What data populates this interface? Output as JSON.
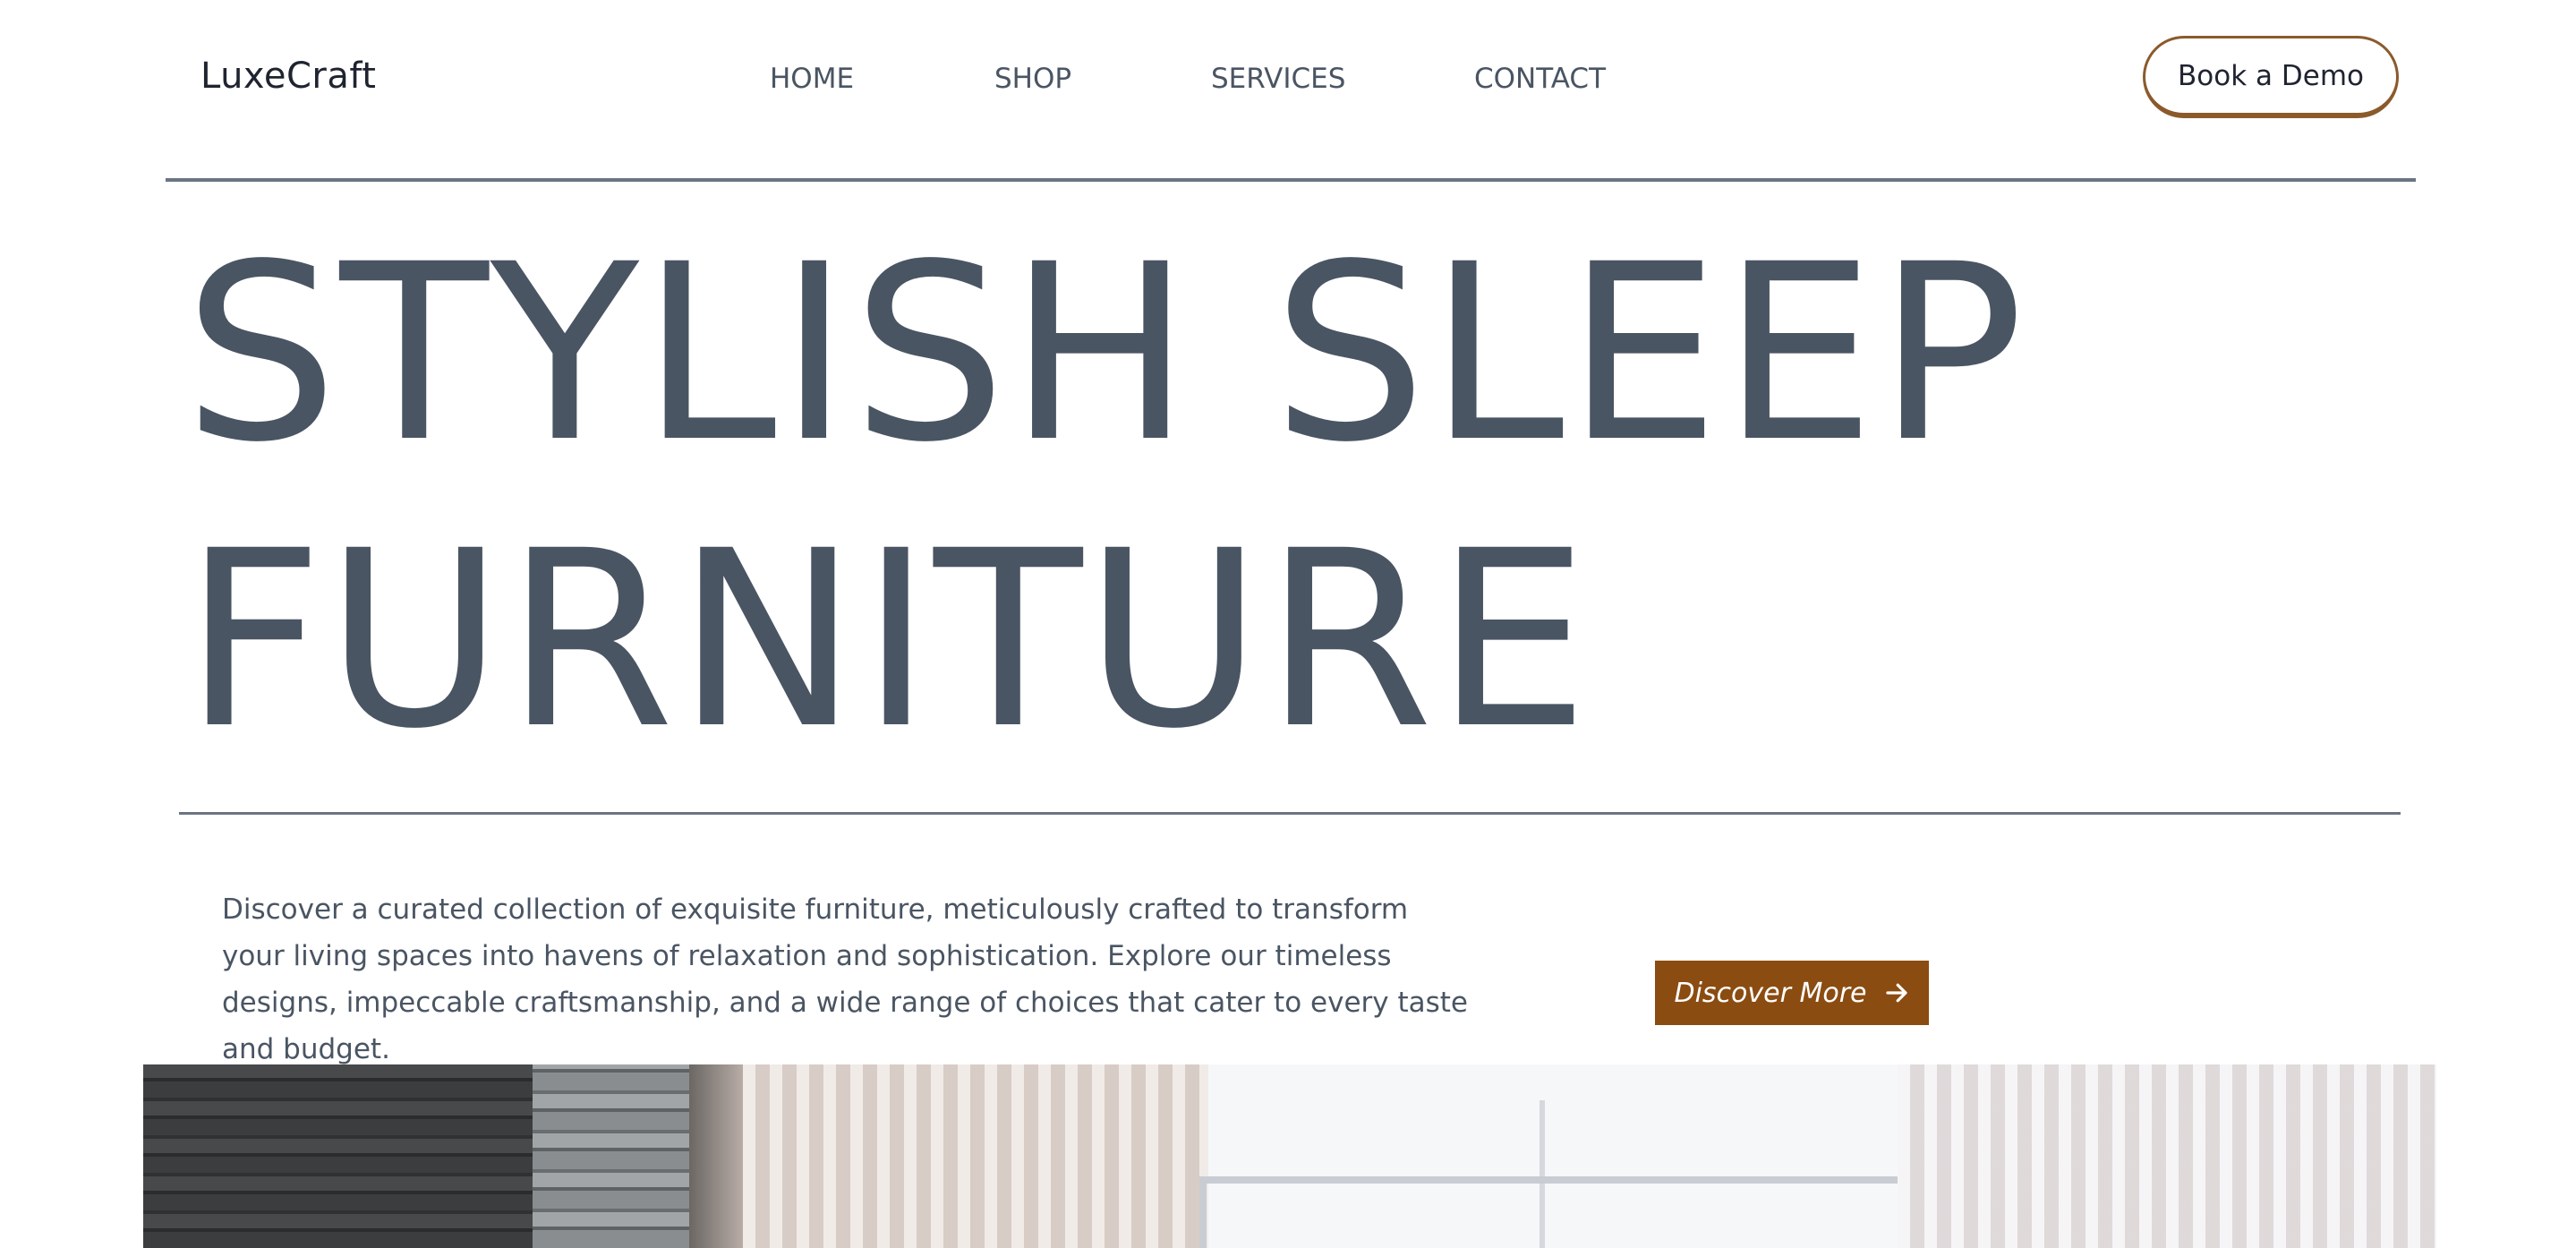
{
  "header": {
    "logo": "LuxeCraft",
    "nav": [
      "HOME",
      "SHOP",
      "SERVICES",
      "CONTACT"
    ],
    "cta_label": "Book a Demo"
  },
  "hero": {
    "title_line1": "STYLISH SLEEP",
    "title_line2": "FURNITURE",
    "description": "Discover a curated collection of exquisite furniture, meticulously crafted to transform your living spaces into havens of relaxation and sophistication. Explore our timeless designs, impeccable craftsmanship, and a wide range of choices that cater to every taste and budget.",
    "button_label": "Discover More",
    "button_icon": "arrow-right-icon",
    "image": "bedroom-interior-image"
  },
  "colors": {
    "text": "#4a5563",
    "accent_brown": "#8b4c11",
    "cta_border": "#8b5a2b",
    "rule": "#6b7484"
  }
}
